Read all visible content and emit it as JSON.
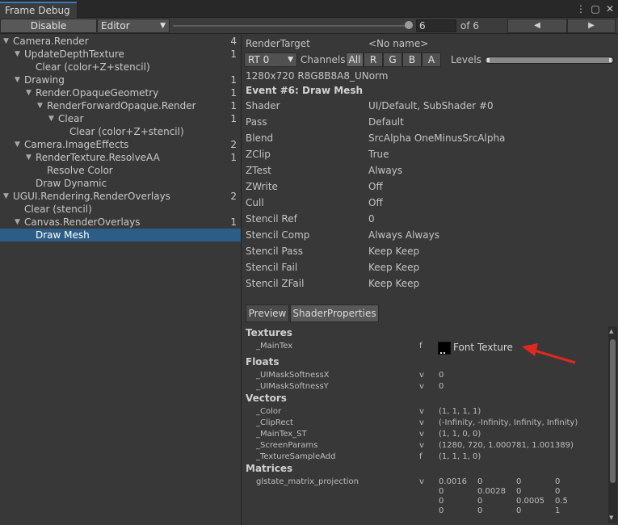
{
  "window": {
    "tab_title": "Frame Debug",
    "icons": [
      "more-icon",
      "maximize-icon",
      "close-icon"
    ]
  },
  "toolbar": {
    "disable_label": "Disable",
    "target_dropdown": "Editor",
    "event_index": "6",
    "of_label": "of 6",
    "prev_glyph": "◀",
    "next_glyph": "▶",
    "slider_position_fraction": 1.0
  },
  "tree": [
    {
      "label": "Camera.Render",
      "count": "4",
      "expanded": true
    },
    {
      "label": "UpdateDepthTexture",
      "count": "1",
      "expanded": true
    },
    {
      "label": "Clear (color+Z+stencil)",
      "count": ""
    },
    {
      "label": "Drawing",
      "count": "1",
      "expanded": true
    },
    {
      "label": "Render.OpaqueGeometry",
      "count": "1",
      "expanded": true
    },
    {
      "label": "RenderForwardOpaque.Render",
      "count": "1",
      "expanded": true
    },
    {
      "label": "Clear",
      "count": "1",
      "expanded": true
    },
    {
      "label": "Clear (color+Z+stencil)",
      "count": ""
    },
    {
      "label": "Camera.ImageEffects",
      "count": "2",
      "expanded": true
    },
    {
      "label": "RenderTexture.ResolveAA",
      "count": "1",
      "expanded": true
    },
    {
      "label": "Resolve Color",
      "count": ""
    },
    {
      "label": "Draw Dynamic",
      "count": ""
    },
    {
      "label": "UGUI.Rendering.RenderOverlays",
      "count": "2",
      "expanded": true
    },
    {
      "label": "Clear (stencil)",
      "count": ""
    },
    {
      "label": "Canvas.RenderOverlays",
      "count": "1",
      "expanded": true
    },
    {
      "label": "Draw Mesh",
      "count": "",
      "selected": true
    }
  ],
  "render_target": {
    "label": "RenderTarget",
    "value": "<No name>",
    "rt_dropdown": "RT 0",
    "channels_label": "Channels",
    "channels": [
      "All",
      "R",
      "G",
      "B",
      "A"
    ],
    "levels_label": "Levels",
    "format": "1280x720 R8G8B8A8_UNorm"
  },
  "event": {
    "title": "Event #6: Draw Mesh",
    "rows": [
      {
        "label": "Shader",
        "value": "UI/Default, SubShader #0"
      },
      {
        "label": "Pass",
        "value": "Default"
      },
      {
        "label": "Blend",
        "value": "SrcAlpha OneMinusSrcAlpha"
      },
      {
        "label": "ZClip",
        "value": "True"
      },
      {
        "label": "ZTest",
        "value": "Always"
      },
      {
        "label": "ZWrite",
        "value": "Off"
      },
      {
        "label": "Cull",
        "value": "Off"
      },
      {
        "label": "Stencil Ref",
        "value": "0"
      },
      {
        "label": "Stencil Comp",
        "value": "Always Always"
      },
      {
        "label": "Stencil Pass",
        "value": "Keep Keep"
      },
      {
        "label": "Stencil Fail",
        "value": "Keep Keep"
      },
      {
        "label": "Stencil ZFail",
        "value": "Keep Keep"
      }
    ]
  },
  "subtabs": {
    "preview": "Preview",
    "shader_properties": "ShaderProperties"
  },
  "properties": {
    "textures_title": "Textures",
    "textures": [
      {
        "name": "_MainTex",
        "type": "f",
        "value": "Font Texture"
      }
    ],
    "floats_title": "Floats",
    "floats": [
      {
        "name": "_UIMaskSoftnessX",
        "type": "v",
        "value": "0"
      },
      {
        "name": "_UIMaskSoftnessY",
        "type": "v",
        "value": "0"
      }
    ],
    "vectors_title": "Vectors",
    "vectors": [
      {
        "name": "_Color",
        "type": "v",
        "value": "(1, 1, 1, 1)"
      },
      {
        "name": "_ClipRect",
        "type": "v",
        "value": "(-Infinity, -Infinity, Infinity, Infinity)"
      },
      {
        "name": "_MainTex_ST",
        "type": "v",
        "value": "(1, 1, 0, 0)"
      },
      {
        "name": "_ScreenParams",
        "type": "v",
        "value": "(1280, 720, 1.000781, 1.001389)"
      },
      {
        "name": "_TextureSampleAdd",
        "type": "f",
        "value": "(1, 1, 1, 0)"
      }
    ],
    "matrices_title": "Matrices",
    "matrix": {
      "name": "glstate_matrix_projection",
      "type": "v",
      "rows": [
        [
          "0.0016",
          "0",
          "0",
          "0"
        ],
        [
          "0",
          "0.0028",
          "0",
          "0"
        ],
        [
          "0",
          "0",
          "0.0005",
          "0.5"
        ],
        [
          "0",
          "0",
          "0",
          "1"
        ]
      ]
    }
  },
  "colors": {
    "selection": "#2c5d87",
    "accent_tab": "#3a79bb",
    "annotation_arrow": "#e0281e"
  }
}
